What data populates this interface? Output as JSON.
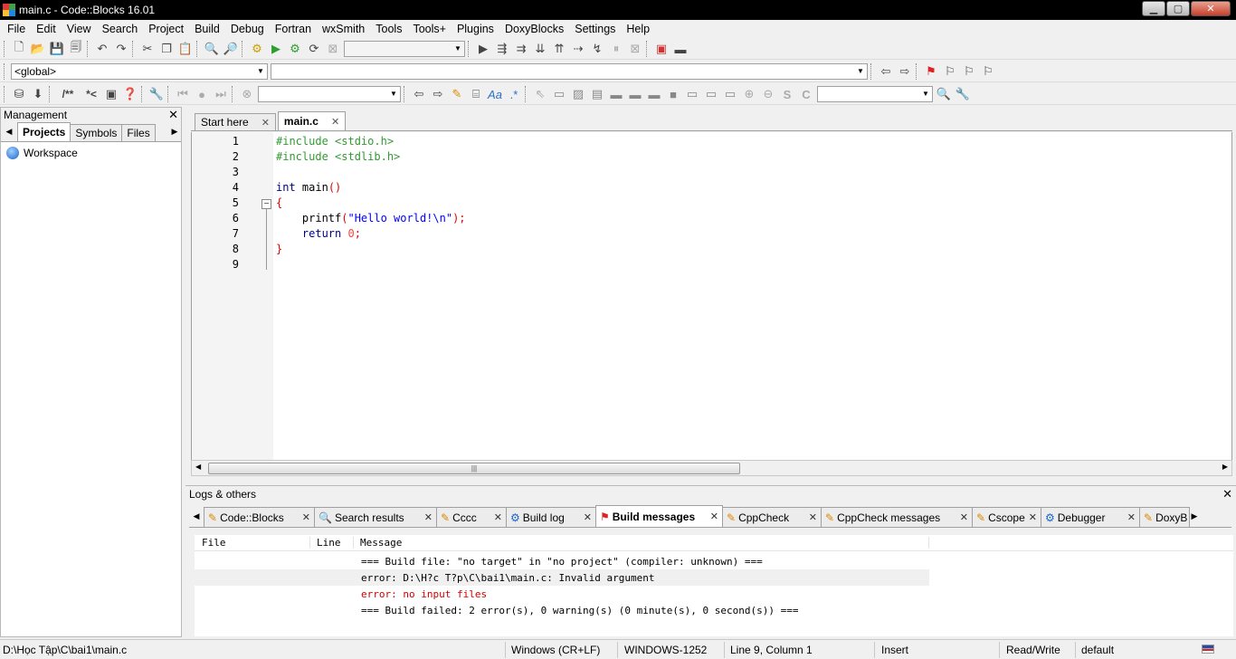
{
  "window": {
    "title": "main.c - Code::Blocks 16.01"
  },
  "menu": [
    "File",
    "Edit",
    "View",
    "Search",
    "Project",
    "Build",
    "Debug",
    "Fortran",
    "wxSmith",
    "Tools",
    "Tools+",
    "Plugins",
    "DoxyBlocks",
    "Settings",
    "Help"
  ],
  "toolbar": {
    "scope_combo": "<global>",
    "function_combo": "",
    "build_target_combo": "",
    "search_combo": "",
    "search_combo2": ""
  },
  "management": {
    "title": "Management",
    "tabs": [
      "Projects",
      "Symbols",
      "Files"
    ],
    "active_tab": "Projects",
    "tree": [
      {
        "label": "Workspace",
        "icon": "workspace-icon"
      }
    ]
  },
  "editor": {
    "tabs": [
      {
        "label": "Start here",
        "active": false
      },
      {
        "label": "main.c",
        "active": true
      }
    ],
    "lines": [
      {
        "n": "1",
        "parts": [
          {
            "t": "#include <stdio.h>",
            "c": "pre"
          }
        ]
      },
      {
        "n": "2",
        "parts": [
          {
            "t": "#include <stdlib.h>",
            "c": "pre"
          }
        ]
      },
      {
        "n": "3",
        "parts": []
      },
      {
        "n": "4",
        "parts": [
          {
            "t": "int",
            "c": "kw"
          },
          {
            "t": " main",
            "c": "id"
          },
          {
            "t": "()",
            "c": "op"
          }
        ]
      },
      {
        "n": "5",
        "parts": [
          {
            "t": "{",
            "c": "op"
          }
        ]
      },
      {
        "n": "6",
        "parts": [
          {
            "t": "    printf",
            "c": "id"
          },
          {
            "t": "(",
            "c": "op"
          },
          {
            "t": "\"Hello world!\\n\"",
            "c": "str"
          },
          {
            "t": ");",
            "c": "op"
          }
        ]
      },
      {
        "n": "7",
        "parts": [
          {
            "t": "    return",
            "c": "kw"
          },
          {
            "t": " 0",
            "c": "num"
          },
          {
            "t": ";",
            "c": "op"
          }
        ]
      },
      {
        "n": "8",
        "parts": [
          {
            "t": "}",
            "c": "op"
          }
        ]
      },
      {
        "n": "9",
        "parts": []
      }
    ],
    "colors": {
      "pre": "#339933",
      "kw": "#00008b",
      "id": "#000000",
      "op": "#e00000",
      "str": "#0000ff",
      "num": "#ff4040"
    }
  },
  "logs": {
    "title": "Logs & others",
    "tabs": [
      {
        "label": "Code::Blocks",
        "icon": "pencil-icon",
        "w": 123
      },
      {
        "label": "Search results",
        "icon": "search-icon",
        "w": 136
      },
      {
        "label": "Cccc",
        "icon": "pencil-icon",
        "w": 78
      },
      {
        "label": "Build log",
        "icon": "gear-icon",
        "w": 100
      },
      {
        "label": "Build messages",
        "icon": "flag-icon",
        "w": 141,
        "active": true
      },
      {
        "label": "CppCheck",
        "icon": "pencil-icon",
        "w": 110
      },
      {
        "label": "CppCheck messages",
        "icon": "pencil-icon",
        "w": 168
      },
      {
        "label": "Cscope",
        "icon": "pencil-icon",
        "w": 77
      },
      {
        "label": "Debugger",
        "icon": "gear-icon",
        "w": 110
      },
      {
        "label": "DoxyB",
        "icon": "pencil-icon",
        "w": 56
      }
    ],
    "columns": [
      "File",
      "Line",
      "Message"
    ],
    "messages": [
      {
        "text": "=== Build file: \"no target\" in \"no project\" (compiler: unknown) ===",
        "color": "#000000"
      },
      {
        "text": "error: D:\\H?c T?p\\C\\bai1\\main.c: Invalid argument",
        "color": "#000000",
        "selected": true
      },
      {
        "text": "error: no input files",
        "color": "#d00000"
      },
      {
        "text": "=== Build failed: 2 error(s), 0 warning(s) (0 minute(s), 0 second(s)) ===",
        "color": "#000000"
      }
    ]
  },
  "status": {
    "path": "D:\\Học Tập\\C\\bai1\\main.c",
    "eol": "Windows (CR+LF)",
    "encoding": "WINDOWS-1252",
    "position": "Line 9, Column 1",
    "mode": "Insert",
    "access": "Read/Write",
    "profile": "default"
  }
}
